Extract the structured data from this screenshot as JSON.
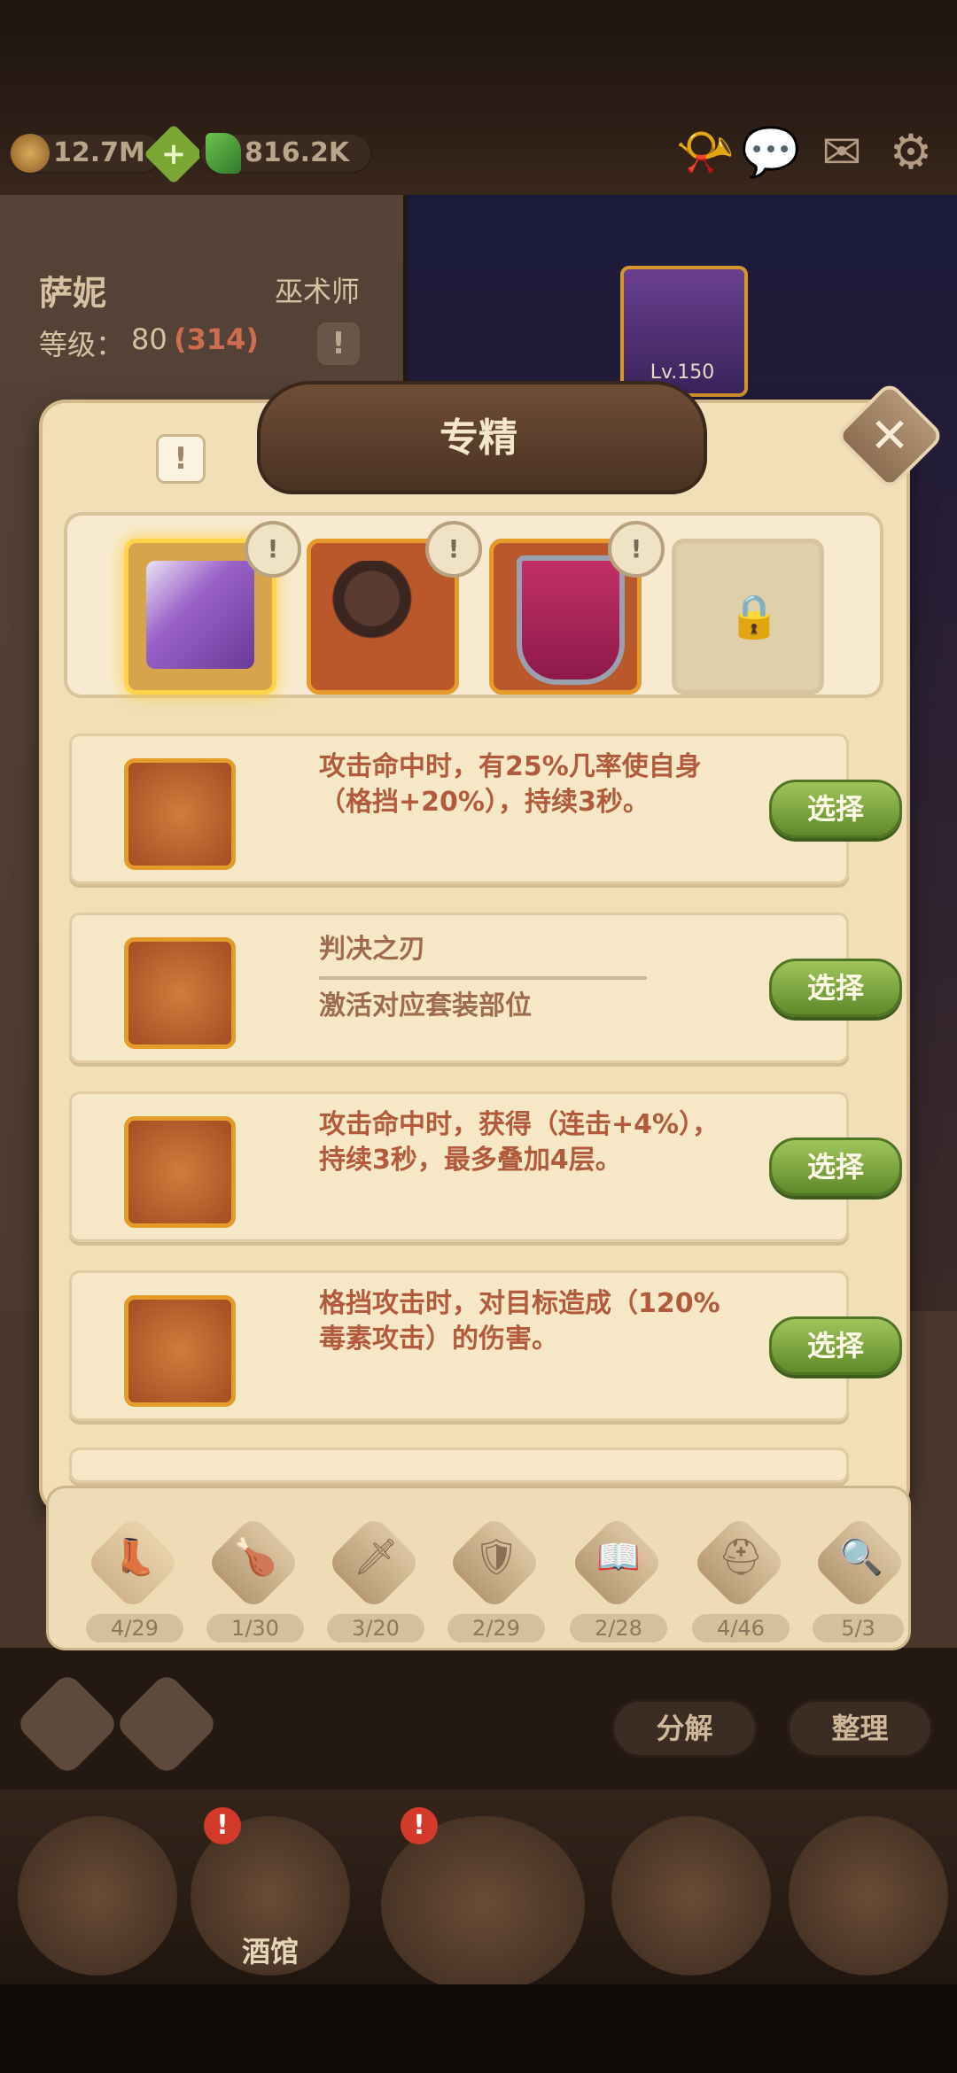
{
  "resources": {
    "gold": "12.7M",
    "gems": "816.2K",
    "icons": [
      "gold-coin-icon",
      "plus-gem-icon",
      "green-gem-icon"
    ]
  },
  "top_icons": [
    "horn-icon",
    "chat-icon",
    "mail-icon",
    "settings-icon"
  ],
  "hero": {
    "name": "萨妮",
    "class": "巫术师",
    "level_label": "等级：",
    "level": "80",
    "level_bonus": "(314)",
    "card_level": "Lv.150"
  },
  "modal": {
    "title": "专精",
    "info_label": "!",
    "close_label": "✕",
    "slots": [
      {
        "name": "cloak",
        "badge": "!",
        "selected": true
      },
      {
        "name": "staff",
        "badge": "!",
        "selected": false
      },
      {
        "name": "shield",
        "badge": "!",
        "selected": false
      },
      {
        "name": "locked",
        "locked": true
      }
    ],
    "options": [
      {
        "title": "攻击命中时，有25%几率使自身（格挡+20%），持续3秒。",
        "button": "选择",
        "icon": "sword-icon"
      },
      {
        "name": "判决之刃",
        "sub": "激活对应套装部位",
        "button": "选择",
        "icon": "red-hilt-sword-icon"
      },
      {
        "title": "攻击命中时，获得（连击+4%），持续3秒，最多叠加4层。",
        "button": "选择",
        "icon": "purple-sword-icon"
      },
      {
        "title": "格挡攻击时，对目标造成（120%毒素攻击）的伤害。",
        "button": "选择",
        "icon": "mace-sword-icon"
      }
    ]
  },
  "categories": [
    {
      "icon": "boot-icon",
      "count": "4/29"
    },
    {
      "icon": "drumstick-icon",
      "count": "1/30"
    },
    {
      "icon": "sword-icon",
      "count": "3/20"
    },
    {
      "icon": "shield-x-icon",
      "count": "2/29"
    },
    {
      "icon": "book-icon",
      "count": "2/28"
    },
    {
      "icon": "helmet-icon",
      "count": "4/46"
    },
    {
      "icon": "magnifier-icon",
      "count": "5/3"
    }
  ],
  "actions": {
    "decompose": "分解",
    "organize": "整理"
  },
  "nav": {
    "tavern_label": "酒馆",
    "badge": "!"
  },
  "colors": {
    "accent_green": "#7aa832",
    "bonus_red": "#cd6c4e",
    "text_brown": "#b15b3c"
  }
}
